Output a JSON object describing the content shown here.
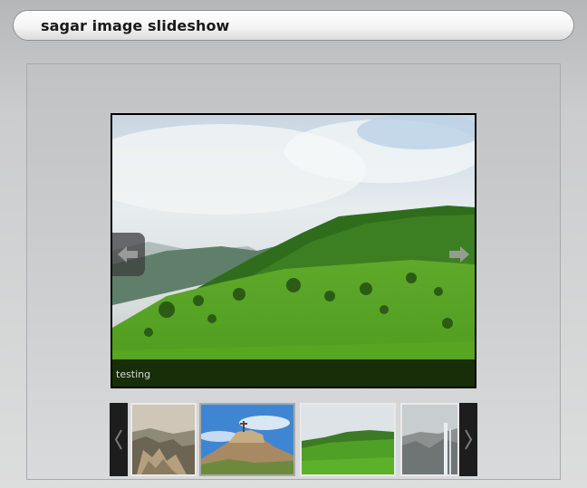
{
  "page": {
    "title": "sagar image slideshow"
  },
  "slideshow": {
    "caption": "testing",
    "prev_icon": "left-arrow-icon",
    "next_icon": "right-arrow-icon"
  },
  "thumbnails": {
    "prev_icon": "chevron-left-icon",
    "next_icon": "chevron-right-icon",
    "items": [
      {
        "subject": "rocky-cliff"
      },
      {
        "subject": "fort-hilltop",
        "selected": true
      },
      {
        "subject": "green-hills"
      },
      {
        "subject": "waterfall"
      }
    ]
  }
}
